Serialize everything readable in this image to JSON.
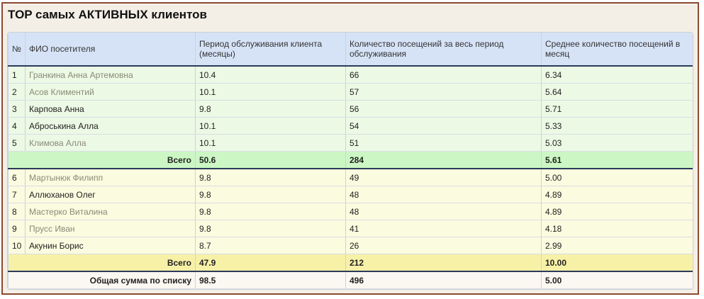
{
  "title": "TOP самых АКТИВНЫХ клиентов",
  "headers": {
    "num": "№",
    "name": "ФИО посетителя",
    "period": "Период обслуживания клиента (месяцы)",
    "visits": "Количество посещений за весь период обслуживания",
    "avg": "Среднее количество посещений в месяц"
  },
  "group1": [
    {
      "num": "1",
      "name": "Гранкина Анна Артемовна",
      "period": "10.4",
      "visits": "66",
      "avg": "6.34"
    },
    {
      "num": "2",
      "name": "Асов Климентий",
      "period": "10.1",
      "visits": "57",
      "avg": "5.64"
    },
    {
      "num": "3",
      "name": "Карпова Анна",
      "period": "9.8",
      "visits": "56",
      "avg": "5.71"
    },
    {
      "num": "4",
      "name": "Аброськина Алла",
      "period": "10.1",
      "visits": "54",
      "avg": "5.33"
    },
    {
      "num": "5",
      "name": "Климова Алла",
      "period": "10.1",
      "visits": "51",
      "avg": "5.03"
    }
  ],
  "subtotal1": {
    "label": "Всего",
    "period": "50.6",
    "visits": "284",
    "avg": "5.61"
  },
  "group2": [
    {
      "num": "6",
      "name": "Мартынюк Филипп",
      "period": "9.8",
      "visits": "49",
      "avg": "5.00"
    },
    {
      "num": "7",
      "name": "Аллюханов Олег",
      "period": "9.8",
      "visits": "48",
      "avg": "4.89"
    },
    {
      "num": "8",
      "name": "Мастерко Виталина",
      "period": "9.8",
      "visits": "48",
      "avg": "4.89"
    },
    {
      "num": "9",
      "name": "Прусс Иван",
      "period": "9.8",
      "visits": "41",
      "avg": "4.18"
    },
    {
      "num": "10",
      "name": "Акунин Борис",
      "period": "8.7",
      "visits": "26",
      "avg": "2.99"
    }
  ],
  "subtotal2": {
    "label": "Всего",
    "period": "47.9",
    "visits": "212",
    "avg": "10.00"
  },
  "total": {
    "label": "Общая сумма по списку",
    "period": "98.5",
    "visits": "496",
    "avg": "5.00"
  }
}
